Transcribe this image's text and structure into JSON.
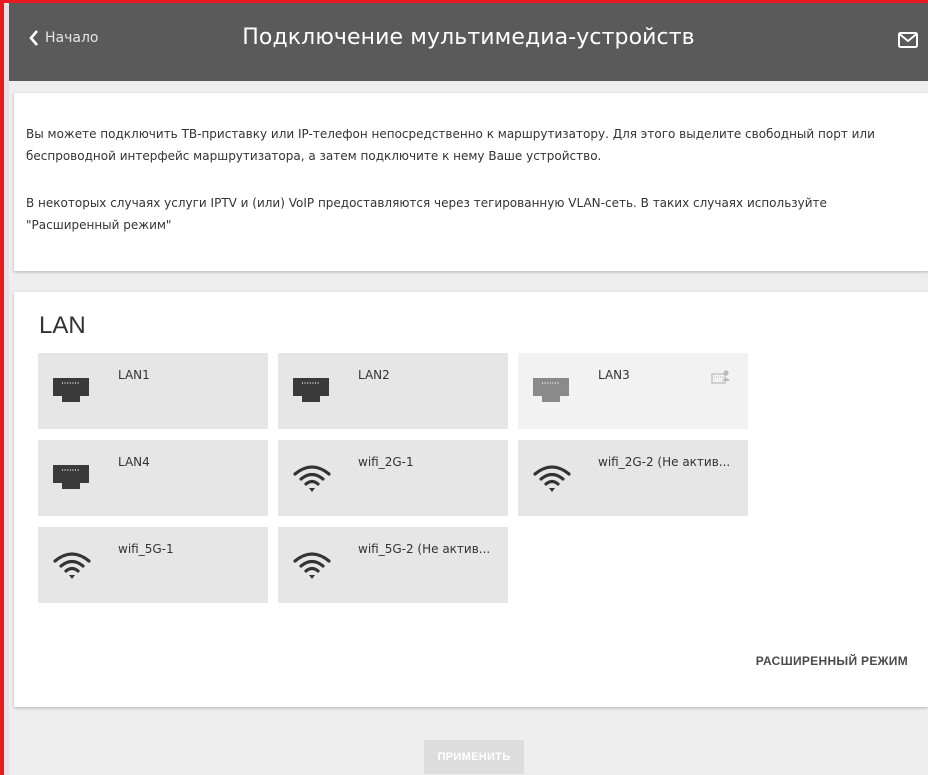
{
  "header": {
    "back_label": "Начало",
    "title": "Подключение мультимедиа-устройств"
  },
  "info": {
    "paragraph1": "Вы можете подключить ТВ-приставку или IP-телефон непосредственно к маршрутизатору. Для этого выделите свободный порт или беспроводной интерфейс маршрутизатора, а затем подключите к нему Ваше устройство.",
    "paragraph2": "В некоторых случаях услуги IPTV и (или) VoIP предоставляются через тегированную VLAN-сеть. В таких случаях используйте \"Расширенный режим\""
  },
  "lan": {
    "title": "LAN",
    "ports": [
      {
        "label": "LAN1",
        "icon": "ethernet-port-icon",
        "disabled": false
      },
      {
        "label": "LAN2",
        "icon": "ethernet-port-icon",
        "disabled": false
      },
      {
        "label": "LAN3",
        "icon": "ethernet-port-icon",
        "disabled": true,
        "extra_icon": "wan-port-icon"
      },
      {
        "label": "LAN4",
        "icon": "ethernet-port-icon",
        "disabled": false
      },
      {
        "label": "wifi_2G-1",
        "icon": "wifi-icon",
        "disabled": false
      },
      {
        "label": "wifi_2G-2 (Не актив...",
        "icon": "wifi-icon",
        "disabled": false
      },
      {
        "label": "wifi_5G-1",
        "icon": "wifi-icon",
        "disabled": false
      },
      {
        "label": "wifi_5G-2 (Не актив...",
        "icon": "wifi-icon",
        "disabled": false
      }
    ],
    "advanced_label": "РАСШИРЕННЫЙ РЕЖИМ"
  },
  "footer": {
    "apply_label": "ПРИМЕНИТЬ"
  },
  "colors": {
    "header_bg": "#5a5a5a",
    "tile_bg": "#e6e6e6",
    "tile_disabled_bg": "#f2f2f2",
    "port_icon": "#3a3a3a",
    "port_icon_disabled": "#8a8a8a",
    "frame": "#e8191f"
  }
}
